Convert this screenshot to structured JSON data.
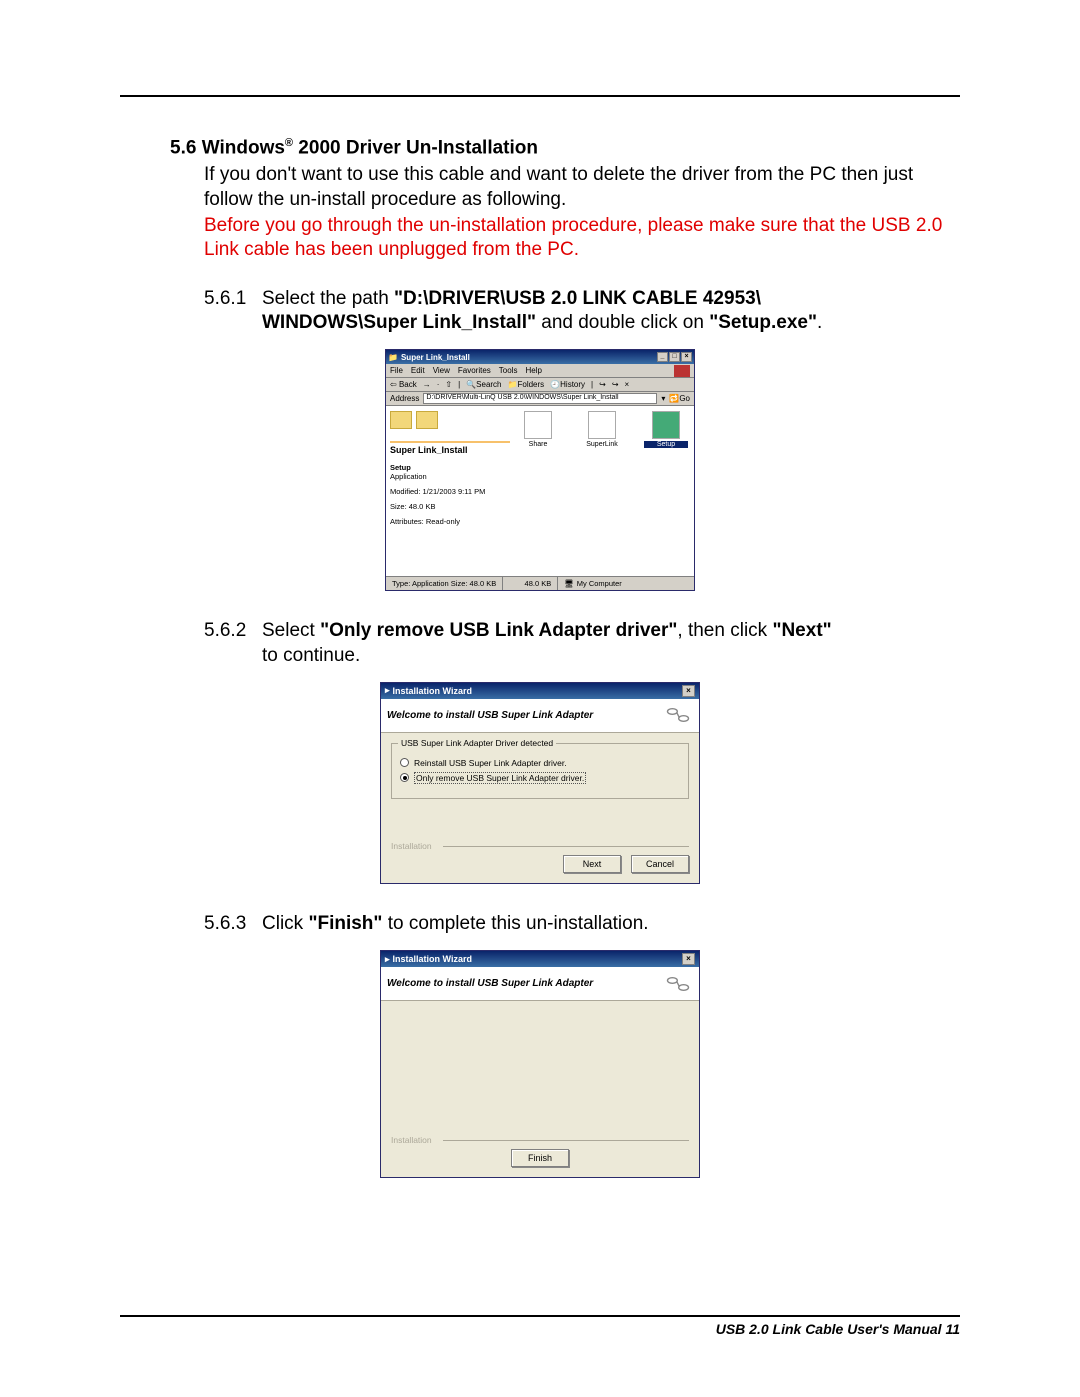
{
  "section": {
    "number": "5.6",
    "title_prefix": "Windows",
    "title_reg": "®",
    "title_suffix": " 2000 Driver Un-Installation"
  },
  "intro": "If you don't want to use this cable and want to delete the driver from the PC then just follow the un-install procedure as following.",
  "warning": "Before you go through the un-installation procedure, please make sure that the USB 2.0 Link cable has been unplugged from the PC.",
  "steps": {
    "s1": {
      "num": "5.6.1",
      "lead": "Select the path ",
      "boldpath": "\"D:\\DRIVER\\USB 2.0 LINK CABLE 42953\\",
      "line2_bold": "WINDOWS\\Super Link_Install\"",
      "line2_rest": " and double click on ",
      "line2_bold2": "\"Setup.exe\"",
      "line2_end": "."
    },
    "s2": {
      "num": "5.6.2",
      "lead": "Select ",
      "bold1": "\"Only remove USB Link Adapter driver\"",
      "mid": ", then click ",
      "bold2": "\"Next\"",
      "cont": "to continue."
    },
    "s3": {
      "num": "5.6.3",
      "lead": "Click ",
      "bold1": "\"Finish\"",
      "rest": " to complete this un-installation."
    }
  },
  "explorer": {
    "title": "Super Link_Install",
    "menus": [
      "File",
      "Edit",
      "View",
      "Favorites",
      "Tools",
      "Help"
    ],
    "toolbar": {
      "back": "Back",
      "search": "Search",
      "folders": "Folders",
      "history": "History"
    },
    "address_label": "Address",
    "address_value": "D:\\DRIVER\\Multi-LinQ USB 2.0\\WINDOWS\\Super Link_Install",
    "go": "Go",
    "left_title": "Super Link_Install",
    "details": {
      "name": "Setup",
      "type": "Application",
      "modified": "Modified: 1/21/2003 9:11 PM",
      "size": "Size: 48.0 KB",
      "attrs": "Attributes: Read-only"
    },
    "items": [
      {
        "label": "Share"
      },
      {
        "label": "SuperLink"
      },
      {
        "label": "Setup",
        "selected": true
      }
    ],
    "status": {
      "left": "Type: Application Size: 48.0 KB",
      "mid": "48.0 KB",
      "right": "My Computer"
    }
  },
  "wizard1": {
    "title": "Installation  Wizard",
    "header": "Welcome to install USB Super Link Adapter",
    "group_legend": "USB Super Link Adapter Driver detected",
    "opt_reinstall": "Reinstall USB Super Link Adapter driver.",
    "opt_remove": "Only remove USB Super Link Adapter driver.",
    "footer_legend": "Installation",
    "btn_next": "Next",
    "btn_cancel": "Cancel"
  },
  "wizard2": {
    "title": "Installation  Wizard",
    "header": "Welcome to install USB Super Link Adapter",
    "footer_legend": "Installation",
    "btn_finish": "Finish"
  },
  "footer": "USB 2.0 Link Cable User's Manual 11"
}
